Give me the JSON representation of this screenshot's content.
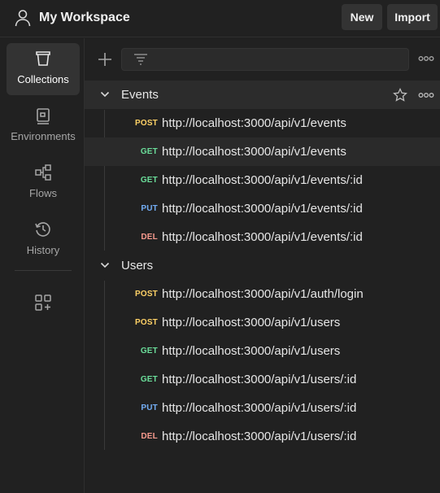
{
  "header": {
    "workspace_title": "My Workspace",
    "new_label": "New",
    "import_label": "Import"
  },
  "sidebar": {
    "items": [
      {
        "label": "Collections",
        "icon": "collections-icon",
        "active": true
      },
      {
        "label": "Environments",
        "icon": "environments-icon",
        "active": false
      },
      {
        "label": "Flows",
        "icon": "flows-icon",
        "active": false
      },
      {
        "label": "History",
        "icon": "history-icon",
        "active": false
      }
    ]
  },
  "colors": {
    "POST": "#ffd166",
    "GET": "#6bdd9a",
    "PUT": "#74aef6",
    "DEL": "#f79a8e"
  },
  "folders": [
    {
      "name": "Events",
      "requests": [
        {
          "method": "POST",
          "url": "http://localhost:3000/api/v1/events"
        },
        {
          "method": "GET",
          "url": "http://localhost:3000/api/v1/events"
        },
        {
          "method": "GET",
          "url": "http://localhost:3000/api/v1/events/:id"
        },
        {
          "method": "PUT",
          "url": "http://localhost:3000/api/v1/events/:id"
        },
        {
          "method": "DEL",
          "url": "http://localhost:3000/api/v1/events/:id"
        }
      ]
    },
    {
      "name": "Users",
      "requests": [
        {
          "method": "POST",
          "url": "http://localhost:3000/api/v1/auth/login"
        },
        {
          "method": "POST",
          "url": "http://localhost:3000/api/v1/users"
        },
        {
          "method": "GET",
          "url": "http://localhost:3000/api/v1/users"
        },
        {
          "method": "GET",
          "url": "http://localhost:3000/api/v1/users/:id"
        },
        {
          "method": "PUT",
          "url": "http://localhost:3000/api/v1/users/:id"
        },
        {
          "method": "DEL",
          "url": "http://localhost:3000/api/v1/users/:id"
        }
      ]
    }
  ]
}
